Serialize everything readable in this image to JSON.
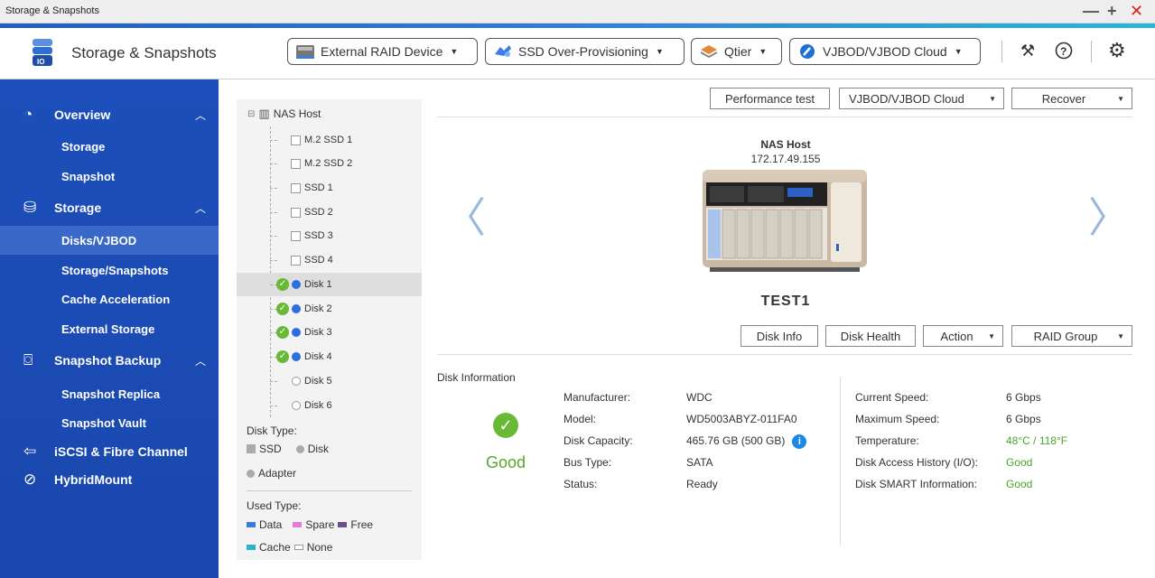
{
  "window": {
    "title": "Storage & Snapshots"
  },
  "header": {
    "app_title": "Storage & Snapshots",
    "buttons": [
      {
        "label": "External RAID Device",
        "icon": "external-raid-icon"
      },
      {
        "label": "SSD Over-Provisioning",
        "icon": "ssd-overprovisioning-icon"
      },
      {
        "label": "Qtier",
        "icon": "qtier-icon"
      },
      {
        "label": "VJBOD/VJBOD Cloud",
        "icon": "vjbod-icon"
      }
    ]
  },
  "sidebar": {
    "groups": [
      {
        "label": "Overview",
        "icon": "dashboard-icon",
        "items": [
          {
            "label": "Storage"
          },
          {
            "label": "Snapshot"
          }
        ]
      },
      {
        "label": "Storage",
        "icon": "database-icon",
        "items": [
          {
            "label": "Disks/VJBOD",
            "active": true
          },
          {
            "label": "Storage/Snapshots"
          },
          {
            "label": "Cache Acceleration"
          },
          {
            "label": "External Storage"
          }
        ]
      },
      {
        "label": "Snapshot Backup",
        "icon": "camera-icon",
        "items": [
          {
            "label": "Snapshot Replica"
          },
          {
            "label": "Snapshot Vault"
          }
        ]
      },
      {
        "label": "iSCSI & Fibre Channel",
        "icon": "iscsi-icon",
        "items": []
      },
      {
        "label": "HybridMount",
        "icon": "link-icon",
        "items": []
      }
    ]
  },
  "tree": {
    "root": "NAS Host",
    "nodes": [
      {
        "label": "M.2 SSD 1",
        "type": "slot"
      },
      {
        "label": "M.2 SSD 2",
        "type": "slot"
      },
      {
        "label": "SSD 1",
        "type": "slot"
      },
      {
        "label": "SSD 2",
        "type": "slot"
      },
      {
        "label": "SSD 3",
        "type": "slot"
      },
      {
        "label": "SSD 4",
        "type": "slot"
      },
      {
        "label": "Disk 1",
        "type": "disk",
        "status": "ok",
        "active": true
      },
      {
        "label": "Disk 2",
        "type": "disk",
        "status": "ok"
      },
      {
        "label": "Disk 3",
        "type": "disk",
        "status": "ok"
      },
      {
        "label": "Disk 4",
        "type": "disk",
        "status": "ok"
      },
      {
        "label": "Disk 5",
        "type": "empty"
      },
      {
        "label": "Disk 6",
        "type": "empty"
      }
    ],
    "legend": {
      "disk_type_title": "Disk Type:",
      "ssd": "SSD",
      "disk": "Disk",
      "adapter": "Adapter",
      "used_type_title": "Used Type:",
      "data": "Data",
      "spare": "Spare",
      "free": "Free",
      "cache": "Cache",
      "none": "None",
      "colors": {
        "data": "#3a7be0",
        "spare": "#e07ce0",
        "free": "#6b4f8c",
        "cache": "#2bb5c8"
      }
    }
  },
  "main": {
    "top_buttons": {
      "performance": "Performance test",
      "vjbod": "VJBOD/VJBOD Cloud",
      "recover": "Recover"
    },
    "nas": {
      "name": "NAS Host",
      "ip": "172.17.49.155"
    },
    "disk_name": "TEST1",
    "disk_buttons": {
      "info": "Disk Info",
      "health": "Disk Health",
      "action": "Action",
      "raid": "RAID Group"
    },
    "info_title": "Disk Information",
    "health_status": "Good",
    "left_info": [
      {
        "key": "Manufacturer:",
        "value": "WDC"
      },
      {
        "key": "Model:",
        "value": "WD5003ABYZ-011FA0"
      },
      {
        "key": "Disk Capacity:",
        "value": "465.76 GB (500 GB)"
      },
      {
        "key": "Bus Type:",
        "value": "SATA"
      },
      {
        "key": "Status:",
        "value": "Ready"
      }
    ],
    "right_info": [
      {
        "key": "Current Speed:",
        "value": "6 Gbps"
      },
      {
        "key": "Maximum Speed:",
        "value": "6 Gbps"
      },
      {
        "key": "Temperature:",
        "value": "48°C / 118°F"
      },
      {
        "key": "Disk Access History (I/O):",
        "value": "Good"
      },
      {
        "key": "Disk SMART Information:",
        "value": "Good"
      }
    ]
  }
}
